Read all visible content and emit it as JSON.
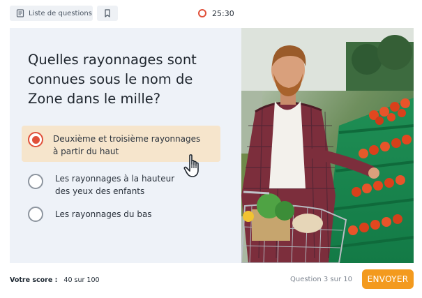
{
  "toolbar": {
    "questions_list_label": "Liste de questions",
    "list_icon": "list-icon",
    "bookmark_icon": "bookmark-icon",
    "timer_icon": "timer-icon",
    "timer": "25:30"
  },
  "quiz": {
    "question": "Quelles rayonnages sont connues sous le nom de Zone dans le mille?",
    "options": [
      {
        "label_line1": "Deuxième et troisième rayonnages",
        "label_line2": "à partir du haut",
        "selected": true
      },
      {
        "label_line1": "Les rayonnages à la hauteur",
        "label_line2": "des yeux des enfants",
        "selected": false
      },
      {
        "label_line1": "Les rayonnages du bas",
        "label_line2": "",
        "selected": false
      }
    ],
    "cursor_icon": "hand-pointer-icon"
  },
  "image": {
    "subject": "man-with-shopping-cart-in-produce-aisle"
  },
  "footer": {
    "score_label": "Votre score :",
    "score_value": "40 sur 100",
    "progress": "Question 3 sur 10",
    "send_label": "ENVOYER"
  },
  "colors": {
    "accent_red": "#e0503a",
    "selected_bg": "#f6e5cc",
    "send_button": "#f39a1e",
    "panel_bg": "#eef2f8"
  }
}
